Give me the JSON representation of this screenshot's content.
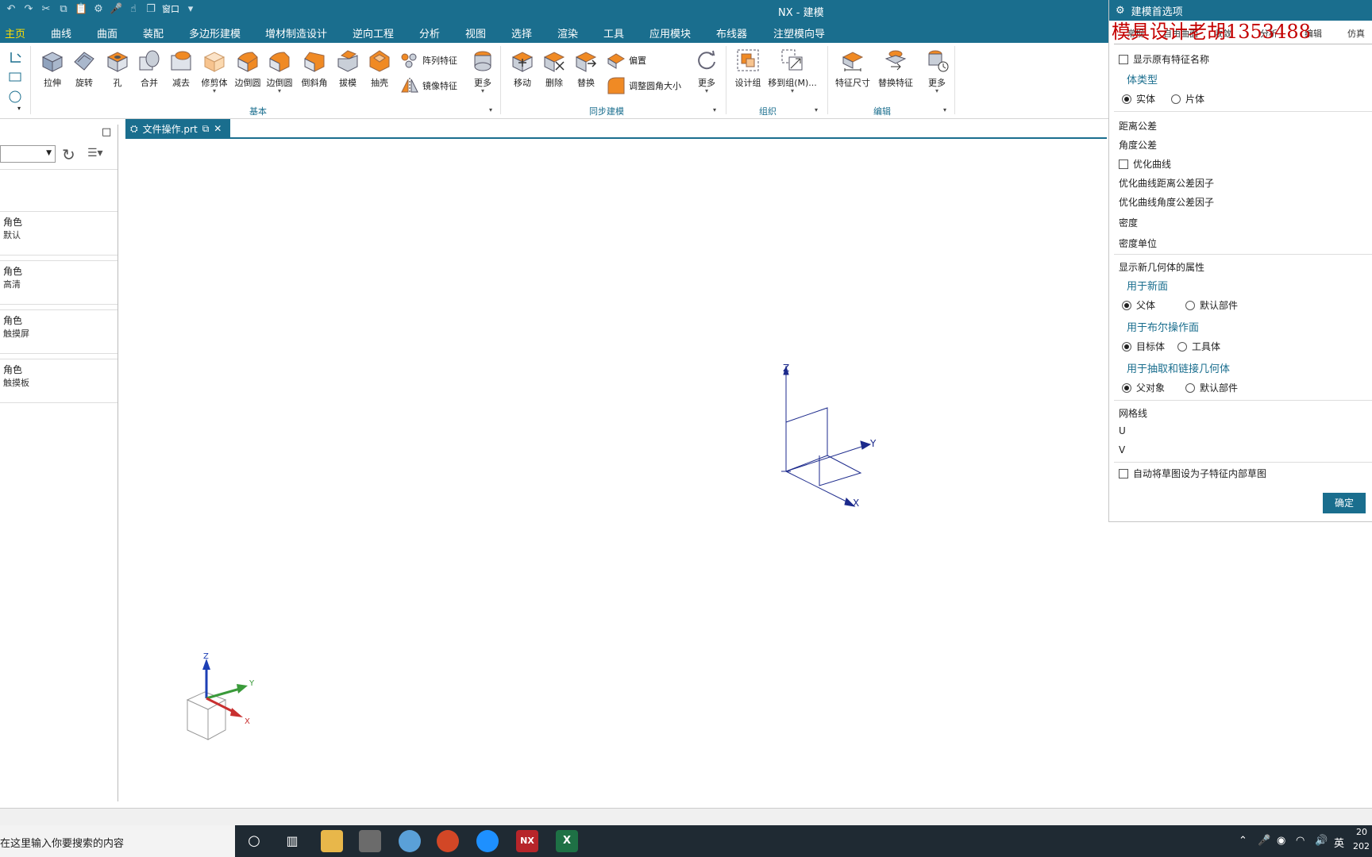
{
  "window": {
    "title": "NX - 建模",
    "window_menu": "窗口"
  },
  "menu": [
    "主页",
    "曲线",
    "曲面",
    "装配",
    "多边形建模",
    "增材制造设计",
    "逆向工程",
    "分析",
    "视图",
    "选择",
    "渲染",
    "工具",
    "应用模块",
    "布线器",
    "注塑模向导"
  ],
  "ribbon": {
    "basic_tools": [
      "拉伸",
      "旋转",
      "孔",
      "合并",
      "减去",
      "修剪体",
      "边倒圆",
      "边倒圆",
      "倒斜角",
      "拔模",
      "抽壳"
    ],
    "pattern_feature": "阵列特征",
    "mirror_feature": "镜像特征",
    "more": "更多",
    "sync_tools": [
      "移动",
      "删除",
      "替换"
    ],
    "offset": "偏置",
    "resize_fillet": "调整圆角大小",
    "org_tools": [
      "设计组",
      "移到组(M)..."
    ],
    "edit_tools": [
      "特征尺寸",
      "替换特征"
    ],
    "groups": {
      "basic": "基本",
      "sync": "同步建模",
      "org": "组织",
      "edit": "编辑"
    }
  },
  "doc_tab": {
    "label": "文件操作.prt"
  },
  "roles": [
    {
      "title": "角色",
      "sub": "默认"
    },
    {
      "title": "角色",
      "sub": "高清"
    },
    {
      "title": "角色",
      "sub": "触摸屏"
    },
    {
      "title": "角色",
      "sub": "触摸板"
    }
  ],
  "axes": {
    "z": "Z",
    "y": "Y",
    "x": "X"
  },
  "dialog": {
    "title": "建模首选项",
    "watermark": "模具设计老胡1353488",
    "tabs": [
      "常规",
      "自由曲面",
      "收敛",
      "分析",
      "编辑",
      "仿真"
    ],
    "show_feature_name": "显示原有特征名称",
    "body_type": "体类型",
    "solid": "实体",
    "sheet": "片体",
    "dist_tol": "距离公差",
    "angle_tol": "角度公差",
    "optimize_curve": "优化曲线",
    "opt_dist_factor": "优化曲线距离公差因子",
    "opt_angle_factor": "优化曲线角度公差因子",
    "density": "密度",
    "density_unit": "密度单位",
    "new_geom_props": "显示新几何体的属性",
    "for_new_face": "用于新面",
    "parent": "父体",
    "default_part": "默认部件",
    "for_bool_face": "用于布尔操作面",
    "target_body": "目标体",
    "tool_body": "工具体",
    "for_extract": "用于抽取和链接几何体",
    "parent_obj": "父对象",
    "default_part2": "默认部件",
    "grid": "网格线",
    "u": "U",
    "v": "V",
    "auto_sketch": "自动将草图设为子特征内部草图",
    "ok": "确定"
  },
  "taskbar": {
    "search": "在这里输入你要搜索的内容",
    "ime": "英",
    "clock_top": "20",
    "clock_bottom": "202"
  }
}
